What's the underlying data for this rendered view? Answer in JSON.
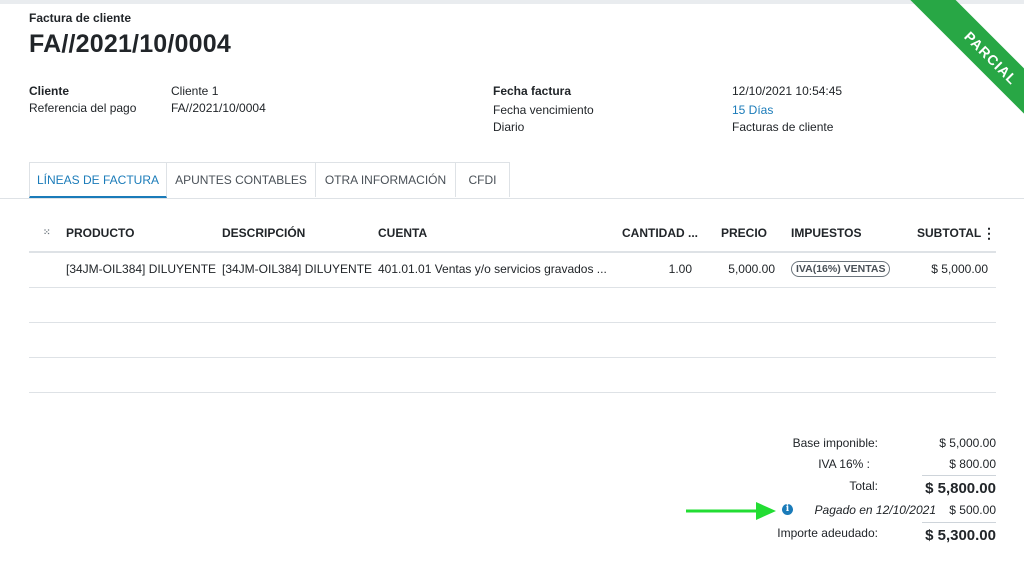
{
  "header": {
    "doc_type": "Factura de cliente",
    "doc_number": "FA//2021/10/0004",
    "ribbon": "PARCIAL"
  },
  "left_fields": [
    {
      "label": "Cliente",
      "value": "Cliente 1"
    },
    {
      "label": "Referencia del pago",
      "value": "FA//2021/10/0004"
    }
  ],
  "right_fields": [
    {
      "label": "Fecha factura",
      "value": "12/10/2021 10:54:45"
    },
    {
      "label": "Fecha vencimiento",
      "value": "15 Días"
    },
    {
      "label": "Diario",
      "value": "Facturas de cliente"
    }
  ],
  "tabs": [
    "LÍNEAS DE FACTURA",
    "APUNTES CONTABLES",
    "OTRA INFORMACIÓN",
    "CFDI"
  ],
  "table": {
    "headers": [
      "PRODUCTO",
      "DESCRIPCIÓN",
      "CUENTA",
      "CANTIDAD ...",
      "PRECIO",
      "IMPUESTOS",
      "SUBTOTAL"
    ],
    "handle_icon": "drag-handle-icon",
    "options_icon": "vertical-dots-icon",
    "rows": [
      {
        "producto": "[34JM-OIL384] DILUYENTE",
        "descripcion": "[34JM-OIL384] DILUYENTE",
        "cuenta": "401.01.01 Ventas y/o servicios gravados ...",
        "cantidad": "1.00",
        "precio": "5,000.00",
        "impuestos": "IVA(16%) VENTAS",
        "subtotal": "$ 5,000.00"
      }
    ]
  },
  "totals": {
    "base_label": "Base imponible:",
    "base_value": "$ 5,000.00",
    "iva_label": "IVA 16% :",
    "iva_value": "$ 800.00",
    "total_label": "Total:",
    "total_value": "$ 5,800.00",
    "paid_label": "Pagado en 12/10/2021",
    "paid_value": "$ 500.00",
    "due_label": "Importe adeudado:",
    "due_value": "$ 5,300.00"
  },
  "colors": {
    "ribbon": "#28a745",
    "accent": "#1a7bb9",
    "arrow": "#22dd33"
  }
}
